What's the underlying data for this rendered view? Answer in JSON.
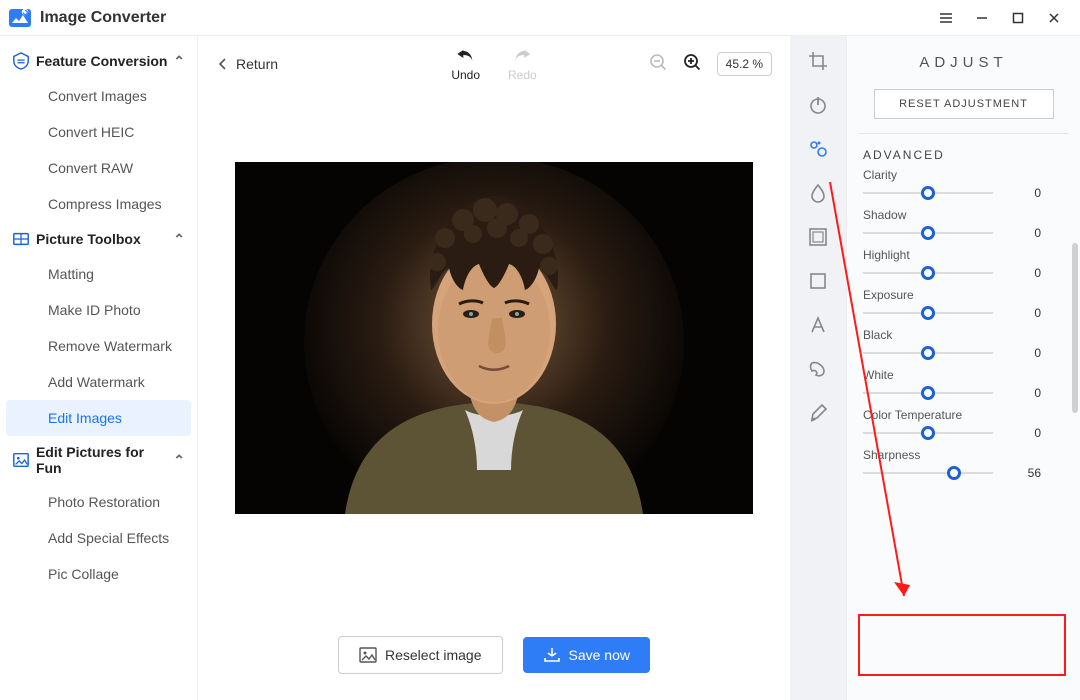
{
  "app": {
    "title": "Image Converter"
  },
  "sidebar": {
    "sections": [
      {
        "label": "Feature Conversion",
        "items": [
          "Convert Images",
          "Convert HEIC",
          "Convert RAW",
          "Compress Images"
        ]
      },
      {
        "label": "Picture Toolbox",
        "items": [
          "Matting",
          "Make ID Photo",
          "Remove Watermark",
          "Add Watermark",
          "Edit Images"
        ]
      },
      {
        "label": "Edit Pictures for Fun",
        "items": [
          "Photo Restoration",
          "Add Special Effects",
          "Pic Collage"
        ]
      }
    ],
    "active_item": "Edit Images"
  },
  "toolbar": {
    "return": "Return",
    "undo": "Undo",
    "redo": "Redo",
    "zoom": "45.2 %"
  },
  "actions": {
    "reselect": "Reselect image",
    "save": "Save now"
  },
  "adjust": {
    "title": "ADJUST",
    "reset": "RESET ADJUSTMENT",
    "advanced_label": "ADVANCED",
    "sliders": [
      {
        "label": "Clarity",
        "value": 0,
        "pos": 50
      },
      {
        "label": "Shadow",
        "value": 0,
        "pos": 50
      },
      {
        "label": "Highlight",
        "value": 0,
        "pos": 50
      },
      {
        "label": "Exposure",
        "value": 0,
        "pos": 50
      },
      {
        "label": "Black",
        "value": 0,
        "pos": 50
      },
      {
        "label": "White",
        "value": 0,
        "pos": 50
      },
      {
        "label": "Color Temperature",
        "value": 0,
        "pos": 50
      },
      {
        "label": "Sharpness",
        "value": 56,
        "pos": 70
      }
    ]
  },
  "tool_icons": [
    "crop-icon",
    "power-icon",
    "adjust-icon",
    "drop-icon",
    "border-icon",
    "square-icon",
    "text-icon",
    "sticker-icon",
    "brush-icon"
  ],
  "active_tool_index": 2
}
